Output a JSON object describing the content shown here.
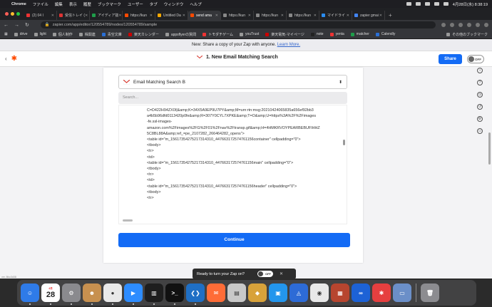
{
  "menubar": {
    "app": "Chrome",
    "items": [
      "ファイル",
      "編集",
      "表示",
      "履歴",
      "ブックマーク",
      "ユーザー",
      "タブ",
      "ウィンドウ",
      "ヘルプ"
    ],
    "clock": "4月28日(水) 8:38:19"
  },
  "tabs": [
    {
      "label": "(2) 04 I",
      "color": "#e33",
      "active": false
    },
    {
      "label": "受信トレイ (",
      "color": "#d33",
      "active": false
    },
    {
      "label": "アイディア抜",
      "color": "#1e9e4a",
      "active": false
    },
    {
      "label": "https://kun",
      "color": "#ff4a00",
      "active": false
    },
    {
      "label": "Untitled Da",
      "color": "#f6a800",
      "active": false
    },
    {
      "label": "send ama",
      "color": "#ff4a00",
      "active": true
    },
    {
      "label": "https://kun",
      "color": "#888",
      "active": false
    },
    {
      "label": "https://kun",
      "color": "#888",
      "active": false
    },
    {
      "label": "https://kun",
      "color": "#888",
      "active": false
    },
    {
      "label": "マイドライ",
      "color": "#2a8cf0",
      "active": false
    },
    {
      "label": "zapier gmai",
      "color": "#4285f4",
      "active": false
    }
  ],
  "toolbar": {
    "url": "zapier.com/app/editor/120554789/nodes/120554789/sample"
  },
  "bookmarks": [
    {
      "label": "drive",
      "color": "#999"
    },
    {
      "label": "light",
      "color": "#999"
    },
    {
      "label": "個人制作",
      "color": "#999"
    },
    {
      "label": "株関連",
      "color": "#999"
    },
    {
      "label": "青空文庫",
      "color": "#2a6fd6"
    },
    {
      "label": "楽天カレンダー",
      "color": "#c00"
    },
    {
      "label": "appsflyerの質問",
      "color": "#999"
    },
    {
      "label": "トモダチゲーム",
      "color": "#e33"
    },
    {
      "label": "youTrust",
      "color": "#999"
    },
    {
      "label": "楽天電気-マイページ",
      "color": "#c00"
    },
    {
      "label": "note",
      "color": "#222"
    },
    {
      "label": "yenta",
      "color": "#e33"
    },
    {
      "label": "matcher",
      "color": "#1e9e4a"
    },
    {
      "label": "Calendly",
      "color": "#2a6fd6"
    }
  ],
  "bookmarks_other": "その他のブックマーク",
  "banner": {
    "text": "New: Share a copy of your Zap with anyone.",
    "link": "Learn More."
  },
  "header": {
    "title": "1. New Email Matching Search",
    "share": "Share",
    "toggle": "OFF"
  },
  "step": {
    "selected": "Email Matching Search B",
    "search_placeholder": "Search...",
    "code_lines": [
      "C=D422H94ZX0I|&amp;K=34X5A9EP9U7PY&amp;M=urn:rtn:msg:20210424065835a656ef92bb3",
      "a4b5b96dfd0113420p0fe&amp;R=307Y0CYL7XPKE&amp;T=O&amp;U=https%3A%2F%2Fimages",
      "-fe.ssl-images-",
      "amazon.com%2Fimages%2FG%2F01%2Fnav%2Ftransp.gif&amp;H=4HMKRVOYPEARBEBUFIHHZ",
      "5C8BL88A&amp;ref_=pe_2107282_266464282_opens\">",
      "<table id=\"m_15617354275217314310_447663172574761156container\" cellpadding=\"0\">",
      "<tbody>",
      "<tr>",
      "<td>",
      "<table id=\"m_15617354275217314310_447663172574761156main\" cellpadding=\"0\">",
      "<tbody>",
      "<tr>",
      "<td>",
      "<table id=\"m_15617354275217314310_447663172574761156header\" cellpadding=\"0\">",
      "<tbody>",
      "<tr>"
    ],
    "continue": "Continue"
  },
  "toast": {
    "text": "Ready to turn your Zap on?",
    "toggle": "OFF"
  },
  "version": "ver. 8fcc3d38",
  "dock": [
    {
      "name": "finder",
      "bg": "#2f7be8",
      "glyph": "☺"
    },
    {
      "name": "calendar",
      "month": "4月",
      "day": "28"
    },
    {
      "name": "system-preferences",
      "bg": "#8a8a8e",
      "glyph": "⚙"
    },
    {
      "name": "contacts",
      "bg": "#c7904f",
      "glyph": "☻"
    },
    {
      "name": "chrome",
      "bg": "#e9e9e9",
      "glyph": "●"
    },
    {
      "name": "zoom",
      "bg": "#2d8cff",
      "glyph": "▶"
    },
    {
      "name": "activity-monitor",
      "bg": "#1e1e1e",
      "glyph": "▥"
    },
    {
      "name": "terminal",
      "bg": "#111",
      "glyph": ">_"
    },
    {
      "name": "vscode",
      "bg": "#1f6fc5",
      "glyph": "❮❯"
    },
    {
      "name": "postman",
      "bg": "#ff6c37",
      "glyph": "✉"
    },
    {
      "name": "sequel",
      "bg": "#c8c8c8",
      "glyph": "▤"
    },
    {
      "name": "cyberduck",
      "bg": "#d8a23a",
      "glyph": "◆"
    },
    {
      "name": "docker",
      "bg": "#2396ed",
      "glyph": "▣"
    },
    {
      "name": "sourcetree",
      "bg": "#2d6bd6",
      "glyph": "◬"
    },
    {
      "name": "keychain",
      "bg": "#e8e8e8",
      "glyph": "◉"
    },
    {
      "name": "preview",
      "bg": "#b7452f",
      "glyph": "▦"
    },
    {
      "name": "infinity",
      "bg": "#1d62d6",
      "glyph": "∞"
    },
    {
      "name": "reminders",
      "bg": "#e63f3f",
      "glyph": "✱"
    },
    {
      "name": "screenshot",
      "bg": "#6b8fc8",
      "glyph": "▭"
    },
    {
      "name": "trash",
      "bg": "#8c8c90",
      "glyph": "🗑"
    }
  ]
}
